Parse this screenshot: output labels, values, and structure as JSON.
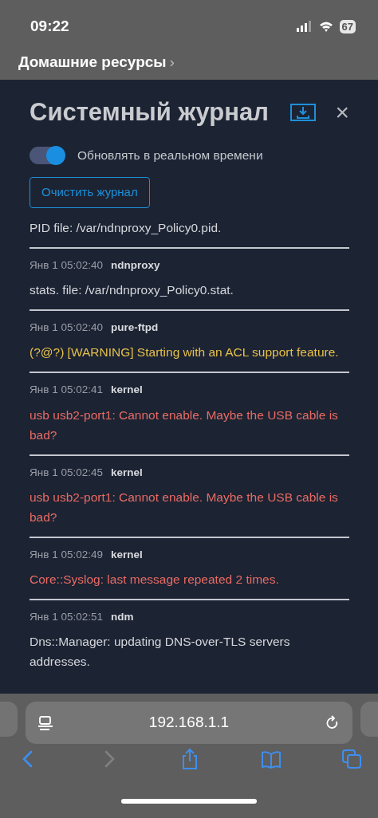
{
  "status_bar": {
    "time": "09:22",
    "battery": "67"
  },
  "breadcrumb": {
    "label": "Домашние ресурсы",
    "chevron": "›"
  },
  "dialog": {
    "title": "Системный журнал",
    "close": "×",
    "live_update": {
      "label": "Обновлять в реальном времени",
      "on": true
    },
    "clear_button": "Очистить журнал",
    "entries": [
      {
        "message": "PID file: /var/ndnproxy_Policy0.pid.",
        "kind": "info"
      },
      {
        "time": "Янв 1 05:02:40",
        "source": "ndnproxy",
        "message": "stats. file: /var/ndnproxy_Policy0.stat.",
        "kind": "info"
      },
      {
        "time": "Янв 1 05:02:40",
        "source": "pure-ftpd",
        "message": "(?@?) [WARNING] Starting with an ACL support feature.",
        "kind": "warning"
      },
      {
        "time": "Янв 1 05:02:41",
        "source": "kernel",
        "message": "usb usb2-port1: Cannot enable. Maybe the USB cable is bad?",
        "kind": "error"
      },
      {
        "time": "Янв 1 05:02:45",
        "source": "kernel",
        "message": "usb usb2-port1: Cannot enable. Maybe the USB cable is bad?",
        "kind": "error"
      },
      {
        "time": "Янв 1 05:02:49",
        "source": "kernel",
        "message": "Core::Syslog: last message repeated 2 times.",
        "kind": "error"
      },
      {
        "time": "Янв 1 05:02:51",
        "source": "ndm",
        "message": "Dns::Manager: updating DNS-over-TLS servers addresses.",
        "kind": "info"
      }
    ]
  },
  "browser": {
    "url": "192.168.1.1",
    "back": {
      "disabled": false
    },
    "forward": {
      "disabled": true
    }
  }
}
